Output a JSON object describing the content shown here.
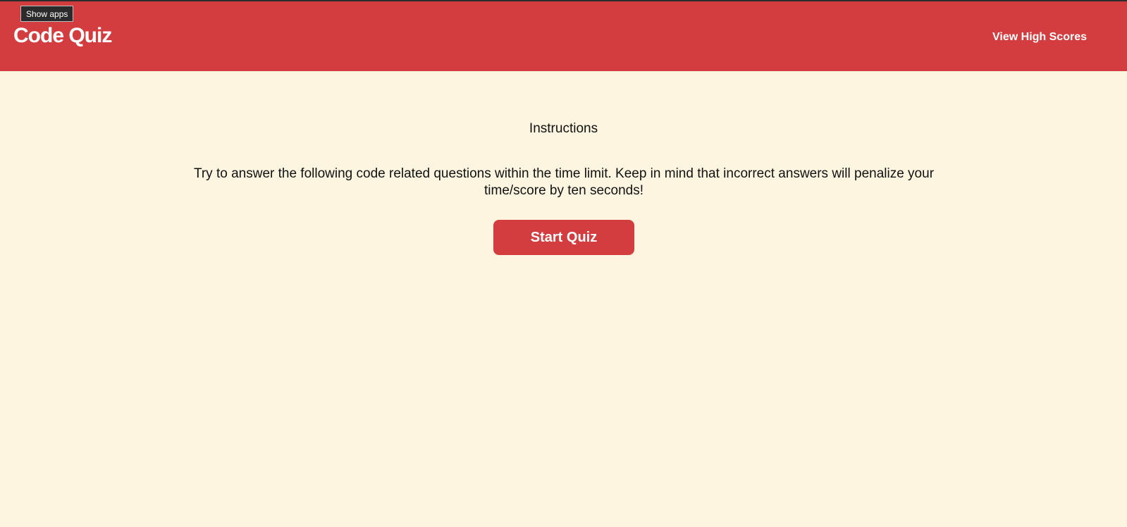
{
  "header": {
    "title": "Code Quiz",
    "high_scores_link": "View High Scores",
    "tooltip": "Show apps"
  },
  "main": {
    "instructions_title": "Instructions",
    "instructions_text": "Try to answer the following code related questions within the time limit. Keep in mind that incorrect answers will penalize your time/score by ten seconds!",
    "start_button": "Start Quiz"
  },
  "colors": {
    "header_bg": "#d43d3f",
    "page_bg": "#fef5e0",
    "button_bg": "#d43d3f",
    "text": "#111111"
  }
}
